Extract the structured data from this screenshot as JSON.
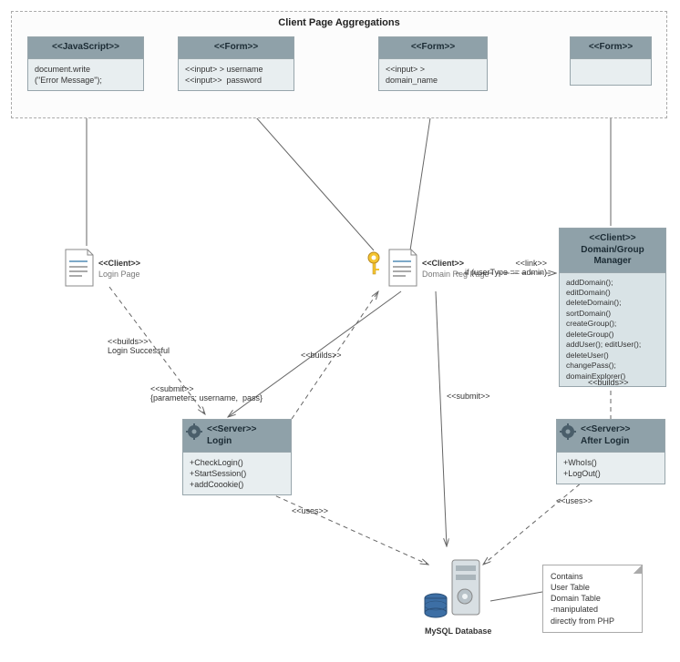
{
  "aggregation": {
    "title": "Client Page Aggregations"
  },
  "boxes": {
    "js": {
      "stereo": "<<JavaScript>>",
      "body": "document.write\n(\"Error Message\");"
    },
    "form1": {
      "stereo": "<<Form>>",
      "body": "<<input> > username\n<<input>>  password"
    },
    "form2": {
      "stereo": "<<Form>>",
      "body": "<<input> >\ndomain_name"
    },
    "form3": {
      "stereo": "<<Form>>",
      "body": ""
    },
    "loginClient": {
      "stereo": "<<Client>>",
      "name": "Login Page"
    },
    "domainClient": {
      "stereo": "<<Client>>",
      "name": "Domain Reg Page"
    },
    "manager": {
      "stereo": "<<Client>>",
      "title": "Domain/Group\nManager",
      "body": "addDomain();\neditDomain()\ndeleteDomain();\nsortDomain()\ncreateGroup();\ndeleteGroup()\naddUser(); editUser();\ndeleteUser()\nchangePass();\ndomainExplorer()"
    },
    "serverLogin": {
      "stereo": "<<Server>>",
      "title": "Login",
      "body": "+CheckLogin()\n+StartSession()\n+addCoookie()"
    },
    "serverAfter": {
      "stereo": "<<Server>>",
      "title": "After Login",
      "body": "+WhoIs()\n+LogOut()"
    }
  },
  "db": {
    "label": "MySQL Database"
  },
  "note": {
    "body": "Contains\nUser Table\nDomain Table\n-manipulated\ndirectly from PHP"
  },
  "labels": {
    "buildsLogin": "<<builds>>\nLogin Successful",
    "builds2": "<<builds>>",
    "builds3": "<<builds>>",
    "submitParams": "<<submit>>\n{parameters: username,  pass}",
    "submit2": "<<submit>>",
    "link": "<<link>>\nif (userType == admin)",
    "uses1": "<<uses>>",
    "uses2": "<<uses>>"
  }
}
